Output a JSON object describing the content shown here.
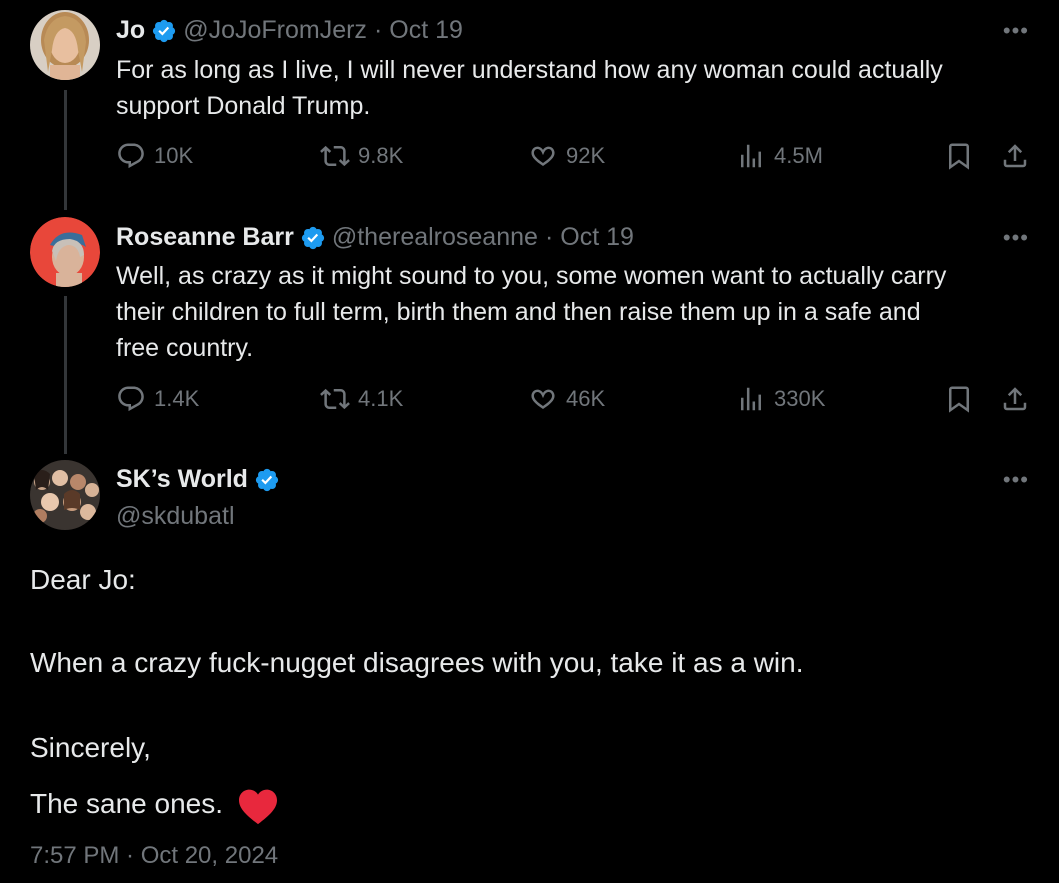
{
  "tweets": [
    {
      "name": "Jo",
      "handle": "@JoJoFromJerz",
      "date": "Oct 19",
      "text_lines": [
        "For as long as I live, I will never understand how any woman could actually",
        "support Donald Trump."
      ],
      "replies": "10K",
      "retweets": "9.8K",
      "likes": "92K",
      "views": "4.5M"
    },
    {
      "name": "Roseanne Barr",
      "handle": "@therealroseanne",
      "date": "Oct 19",
      "text_lines": [
        "Well, as crazy as it might sound to you, some women want to actually carry",
        "their children to full term, birth them and then raise them up in a safe and",
        "free country."
      ],
      "replies": "1.4K",
      "retweets": "4.1K",
      "likes": "46K",
      "views": "330K"
    }
  ],
  "main": {
    "name": "SK’s World",
    "handle": "@skdubatl",
    "greeting": "Dear Jo:",
    "line1": "When a crazy fuck-nugget disagrees with you, take it as a win.",
    "line2": "Sincerely,",
    "line3": "The sane ones.",
    "timestamp": "7:57 PM · Oct 20, 2024"
  },
  "more_label": "•••",
  "dot_separator": "·",
  "colors": {
    "verified": "#1d9bf0",
    "muted": "#71767b",
    "text": "#e7e9ea",
    "heart": "#e8283d"
  }
}
